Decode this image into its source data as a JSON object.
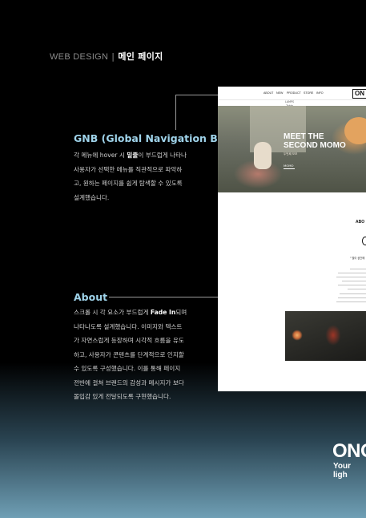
{
  "header": {
    "label_en": "WEB DESIGN",
    "separator": "|",
    "label_kr": "메인 페이지"
  },
  "gnb": {
    "title": "GNB (Global Navigation Bar)",
    "lines": [
      [
        "각 메뉴에 hover 시 ",
        "밑줄",
        "이 부드럽게 나타나"
      ],
      [
        "사용자가 선택한 메뉴를 직관적으로 파악하",
        "",
        ""
      ],
      [
        "고, 원하는 페이지를 쉽게 탐색할 수 있도록",
        "",
        ""
      ],
      [
        "설계했습니다.",
        "",
        ""
      ]
    ]
  },
  "about": {
    "title": "About",
    "lines": [
      [
        "스크롤 시 각 요소가 부드럽게 ",
        "Fade In",
        "되며"
      ],
      [
        "나타나도록 설계했습니다. 이미지와 텍스트",
        "",
        ""
      ],
      [
        "가 자연스럽게 등장하며 시각적 흐름을 유도",
        "",
        ""
      ],
      [
        "하고, 사용자가 콘텐츠를 단계적으로 인지할",
        "",
        ""
      ],
      [
        "수 있도록 구성했습니다. 이를 통해 페이지",
        "",
        ""
      ],
      [
        "전반에 걸쳐 브랜드의 감성과 메시지가 보다",
        "",
        ""
      ],
      [
        "몰입감 있게 전달되도록 구현했습니다.",
        "",
        ""
      ]
    ]
  },
  "mockup": {
    "nav_items": [
      "ABOUT",
      "NEW",
      "PRODUCT",
      "STORE",
      "INFO"
    ],
    "logo": "ON",
    "dropdown": [
      "LAMPS",
      "Table"
    ],
    "hero_title_1": "MEET THE",
    "hero_title_2": "SECOND MOMO",
    "hero_sub": "두번째 모모",
    "hero_link": "MOMO",
    "about_heading": "ABO",
    "about_quote": "\" 빛이 공간에"
  },
  "footer": {
    "brand": "ONO",
    "tagline": "Your ligh"
  }
}
